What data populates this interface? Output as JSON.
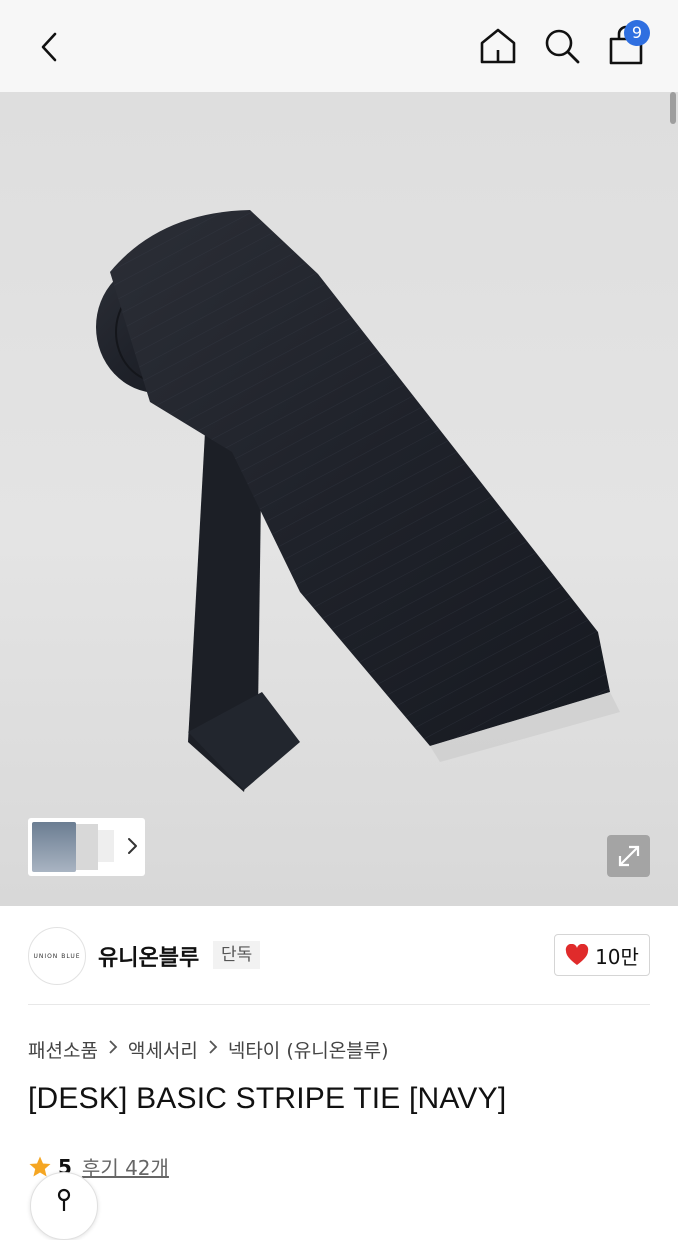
{
  "nav": {
    "back_icon": "chevron-left-icon",
    "home_icon": "home-icon",
    "search_icon": "search-icon",
    "cart_icon": "shopping-bag-icon",
    "cart_count": "9",
    "badge_color": "#2f6fe0"
  },
  "gallery": {
    "expand_icon": "expand-icon",
    "thumbnail_chevron": "chevron-right-icon"
  },
  "brand": {
    "logo_text": "UNION BLUE",
    "name": "유니온블루",
    "exclusive_badge": "단독",
    "like_count": "10만",
    "heart_color": "#e02b2b"
  },
  "breadcrumb": {
    "items": [
      "패션소품",
      "액세서리",
      "넥타이 (유니온블루)"
    ]
  },
  "product": {
    "title": "[DESK] BASIC STRIPE TIE [NAVY]",
    "rating": "5",
    "reviews_label": "후기 42개",
    "star_color": "#f5a623"
  }
}
